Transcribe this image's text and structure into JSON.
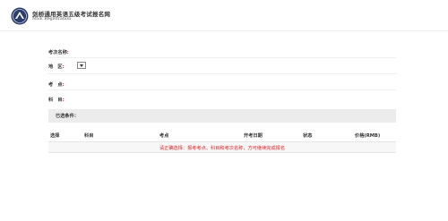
{
  "header": {
    "title": "剑桥通用英语五级考试报名网",
    "subtitle": "MSE Registration",
    "logo_icon": "cambridge-seal-icon"
  },
  "form": {
    "exam_name": {
      "label": "考次名称",
      "colon": ":"
    },
    "region": {
      "label": "地　区",
      "colon": ":"
    },
    "exam_center": {
      "label": "考　点",
      "colon": ":"
    },
    "subject": {
      "label": "科　目",
      "colon": ":"
    }
  },
  "selected": {
    "label": "已选条件："
  },
  "table": {
    "columns": [
      "选择",
      "科目",
      "考点",
      "开考日期",
      "状态",
      "价格(RMB)"
    ],
    "message": "请正确选择：报考考点、科目和考次名称，方可继续完成报名"
  },
  "colors": {
    "accent_red": "#e02424",
    "bar_gray": "#ececec"
  }
}
